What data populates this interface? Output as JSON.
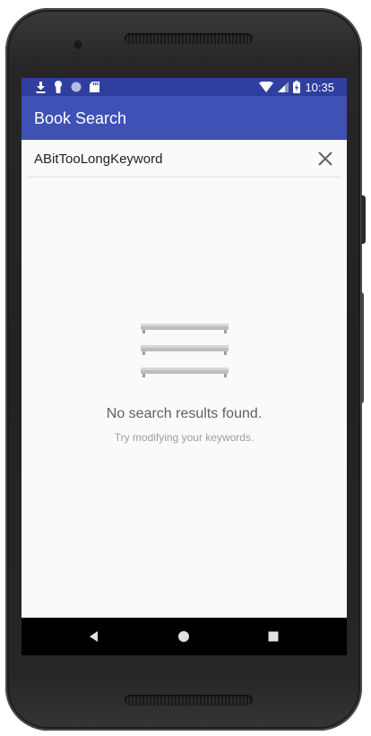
{
  "status_bar": {
    "time": "10:35",
    "left_icons": [
      "download-icon",
      "keyhole-icon",
      "circle-icon",
      "sd-card-icon"
    ],
    "right_icons": [
      "wifi-icon",
      "signal-icon",
      "battery-icon"
    ]
  },
  "app_bar": {
    "title": "Book Search"
  },
  "search": {
    "value": "ABitTooLongKeyword",
    "clear_icon": "close-icon"
  },
  "empty_state": {
    "icon": "bookshelf-icon",
    "title": "No search results found.",
    "subtitle": "Try modifying your keywords."
  },
  "nav_bar": {
    "buttons": [
      "back-icon",
      "home-icon",
      "recents-icon"
    ]
  },
  "colors": {
    "primary": "#3f51b5",
    "primary_dark": "#303f9f",
    "background": "#fafafa"
  }
}
